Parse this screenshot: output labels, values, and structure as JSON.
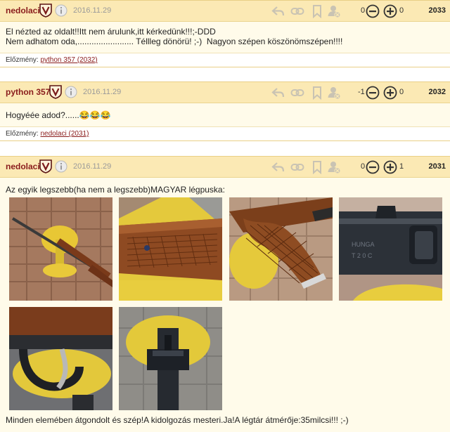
{
  "posts": [
    {
      "author": "nedolaci",
      "date": "2016.11.29",
      "votes_down": "0",
      "votes_up": "0",
      "number": "2033",
      "lines": [
        "El nézted az oldalt!!Itt nem árulunk,itt kérkedünk!!!;-DDD",
        "Nem adhatom oda,........................ Téllleg dönörü! ;-)  Nagyon szépen köszönömszépen!!!!"
      ],
      "prev_label": "Előzmény:",
      "prev_link": "python 357 (2032)"
    },
    {
      "author": "python 357",
      "date": "2016.11.29",
      "votes_down": "-1",
      "votes_up": "0",
      "number": "2032",
      "lines": [
        "Hogyéée adod?......😂😂😂"
      ],
      "prev_label": "Előzmény:",
      "prev_link": "nedolaci (2031)"
    },
    {
      "author": "nedolaci",
      "date": "2016.11.29",
      "votes_down": "0",
      "votes_up": "1",
      "number": "2031",
      "intro": "Az egyik legszebb(ha nem a legszebb)MAGYAR légpuska:",
      "outro": "Minden elemében átgondolt és szép!A kidolgozás mesteri.Ja!A légtár átmérője:35milcsi!!! ;-)"
    }
  ],
  "icons": [
    "shield-v-icon",
    "info-icon",
    "reply-icon",
    "link-icon",
    "bookmark-icon",
    "user-block-icon",
    "minus-circle-icon",
    "plus-circle-icon"
  ],
  "colors": {
    "header_bg": "#fbe9b4",
    "body_bg": "#fffbea",
    "author": "#8a1c1c",
    "link": "#8a1c1c"
  }
}
